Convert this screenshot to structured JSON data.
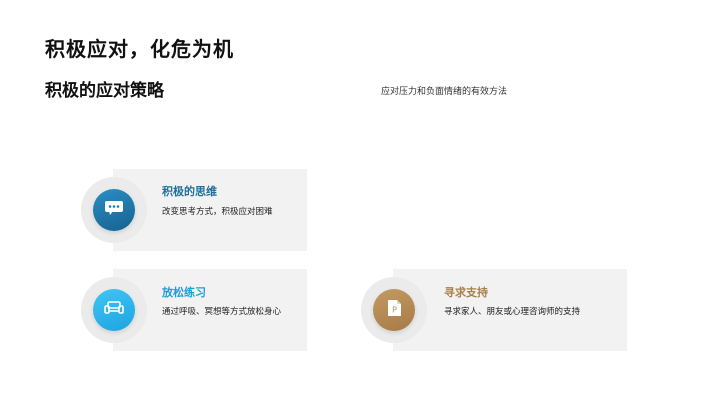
{
  "page": {
    "title": "积极应对，化危为机",
    "subtitle": "积极的应对策略",
    "description": "应对压力和负面情绪的有效方法"
  },
  "cards": [
    {
      "title": "积极的思维",
      "text": "改变思考方式，积极应对困难",
      "icon": "chat-bubble-icon",
      "title_color": "#1e6f9c",
      "icon_color": "#1f7fb4"
    },
    {
      "title": "放松练习",
      "text": "通过呼吸、冥想等方式放松身心",
      "icon": "sofa-icon",
      "title_color": "#1a9fd8",
      "icon_color": "#29b6f0"
    },
    {
      "title": "寻求支持",
      "text": "寻求家人、朋友或心理咨询师的支持",
      "icon": "document-icon",
      "title_color": "#a8804b",
      "icon_color": "#b98d57"
    }
  ]
}
